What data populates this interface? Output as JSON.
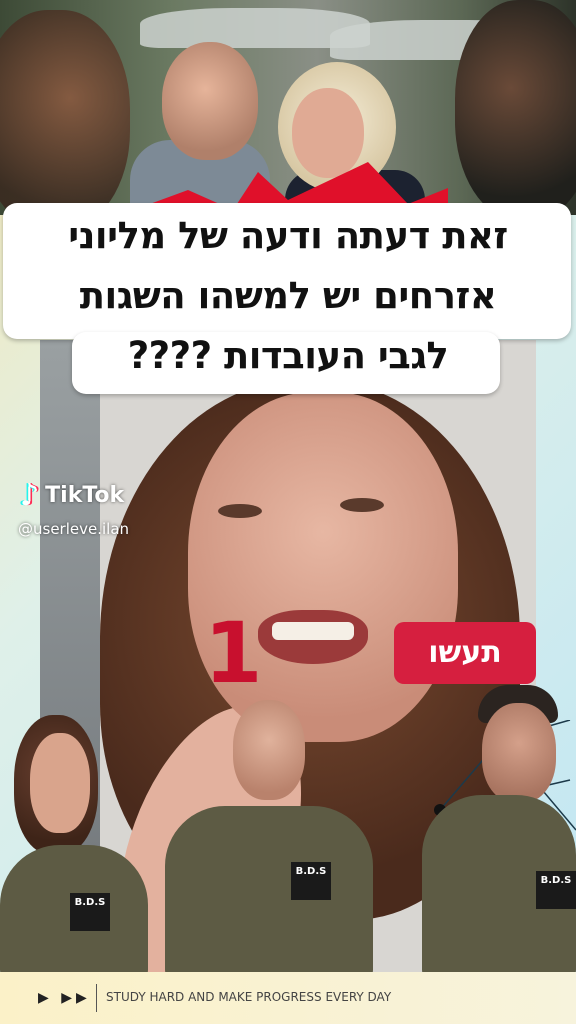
{
  "headline": {
    "line1": "זאת דעתה ודעה של מליוני",
    "line2": "אזרחים יש למשהו השגות",
    "line3": "לגבי העובדות ????"
  },
  "watermark": {
    "brand": "TikTok",
    "username": "@userleve.ilan"
  },
  "overlay": {
    "number": "1",
    "badge_label": "תעשו",
    "badge_color": "#d61f3f"
  },
  "shirt_logo": "B.D.S",
  "footer": {
    "controls": "▶ ▶▶",
    "tagline": "STUDY HARD AND MAKE PROGRESS EVERY DAY"
  }
}
